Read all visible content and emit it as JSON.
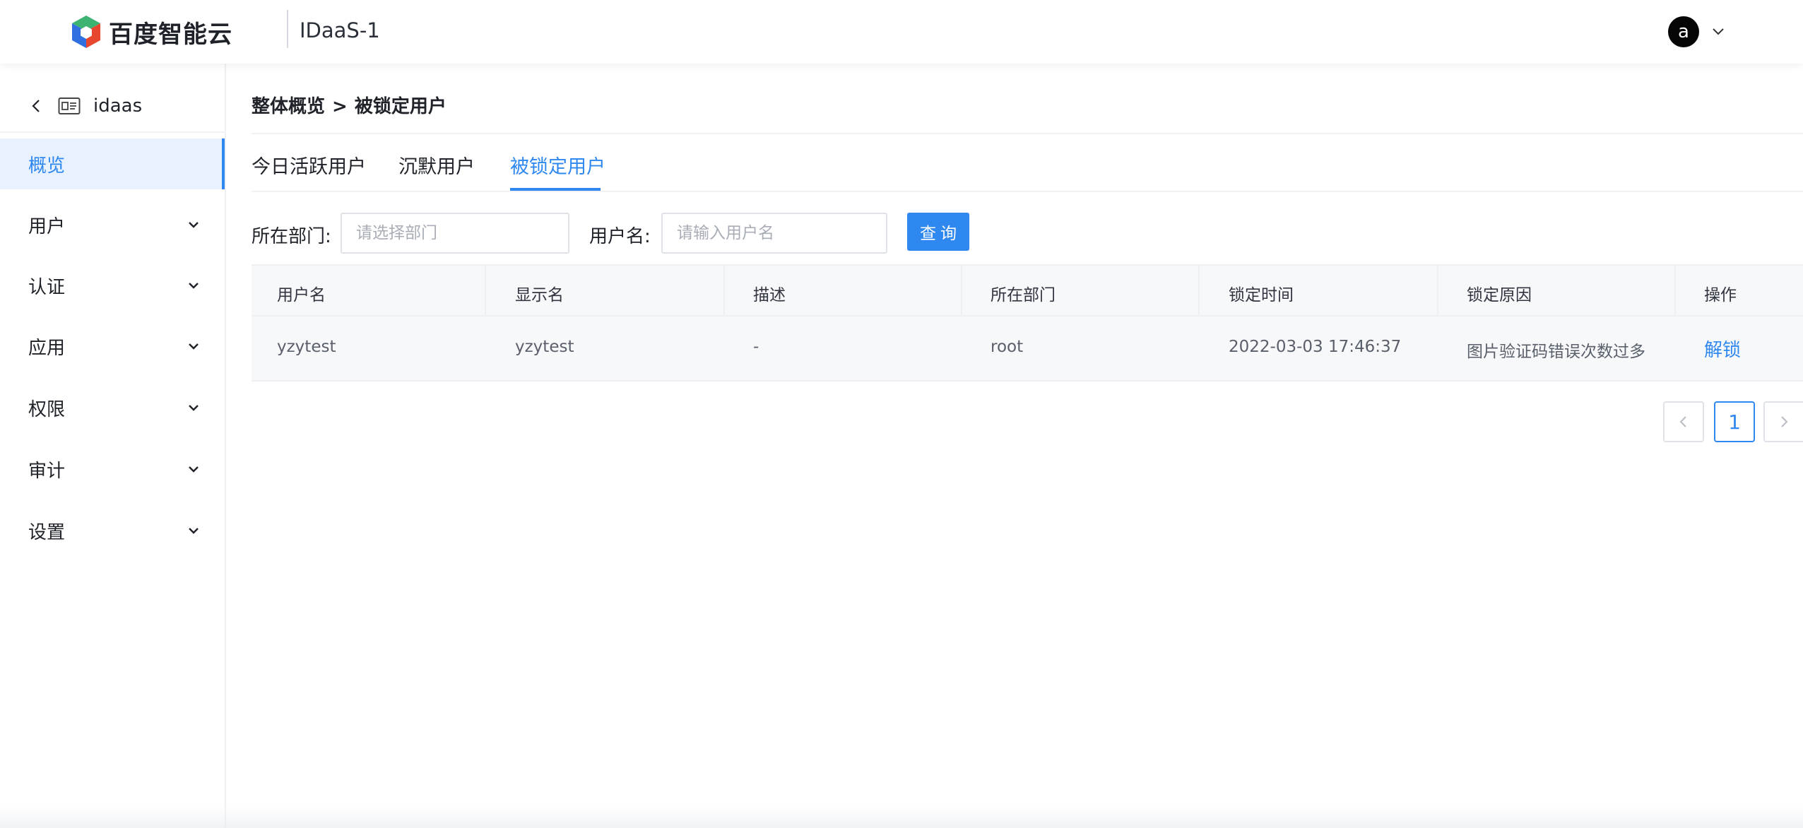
{
  "header": {
    "brand": "百度智能云",
    "app_title": "IDaaS-1",
    "avatar_letter": "a",
    "icons": {
      "logo": "baidu-cube-icon",
      "caret": "chevron-down-icon"
    }
  },
  "sidebar": {
    "back_label": "idaas",
    "items": [
      {
        "label": "概览",
        "active": true
      },
      {
        "label": "用户",
        "expandable": true
      },
      {
        "label": "认证",
        "expandable": true
      },
      {
        "label": "应用",
        "expandable": true
      },
      {
        "label": "权限",
        "expandable": true
      },
      {
        "label": "审计",
        "expandable": true
      },
      {
        "label": "设置",
        "expandable": true
      }
    ]
  },
  "breadcrumb": {
    "parent": "整体概览",
    "separator": ">",
    "current": "被锁定用户"
  },
  "tabs": [
    {
      "label": "今日活跃用户"
    },
    {
      "label": "沉默用户"
    },
    {
      "label": "被锁定用户",
      "active": true
    }
  ],
  "filters": {
    "dept_label": "所在部门:",
    "dept_placeholder": "请选择部门",
    "username_label": "用户名:",
    "username_placeholder": "请输入用户名",
    "query_label": "查询"
  },
  "table": {
    "columns": [
      "用户名",
      "显示名",
      "描述",
      "所在部门",
      "锁定时间",
      "锁定原因",
      "操作"
    ],
    "rows": [
      {
        "username": "yzytest",
        "display_name": "yzytest",
        "description": "-",
        "department": "root",
        "lock_time": "2022-03-03 17:46:37",
        "lock_reason": "图片验证码错误次数过多",
        "action": "解锁"
      }
    ]
  },
  "pagination": {
    "current_page": "1"
  },
  "colors": {
    "accent": "#2f88ef",
    "active_bg": "#e8f2ff"
  }
}
